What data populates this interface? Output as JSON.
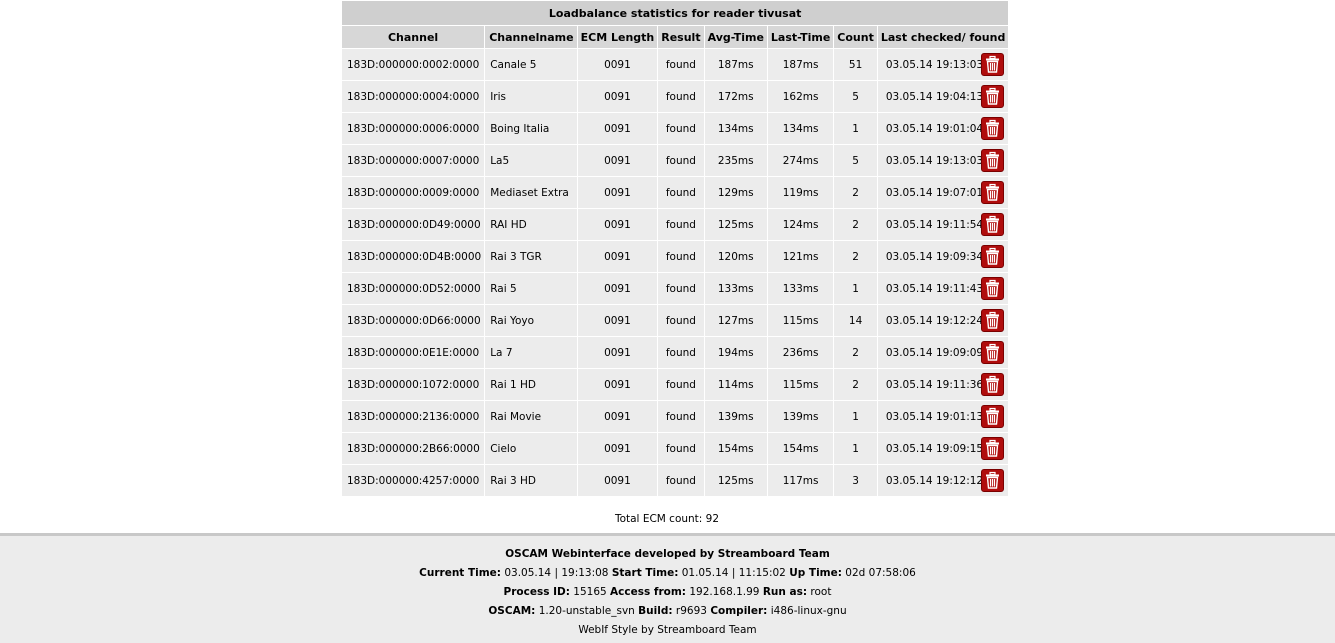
{
  "table": {
    "title": "Loadbalance statistics for reader tivusat",
    "headers": {
      "channel": "Channel",
      "channelname": "Channelname",
      "ecm_length": "ECM Length",
      "result": "Result",
      "avg_time": "Avg-Time",
      "last_time": "Last-Time",
      "count": "Count",
      "last_checked": "Last checked/ found"
    },
    "rows": [
      {
        "channel": "183D:000000:0002:0000",
        "name": "Canale 5",
        "ecm": "0091",
        "result": "found",
        "avg": "187ms",
        "last": "187ms",
        "count": "51",
        "checked": "03.05.14 19:13:03"
      },
      {
        "channel": "183D:000000:0004:0000",
        "name": "Iris",
        "ecm": "0091",
        "result": "found",
        "avg": "172ms",
        "last": "162ms",
        "count": "5",
        "checked": "03.05.14 19:04:13"
      },
      {
        "channel": "183D:000000:0006:0000",
        "name": "Boing Italia",
        "ecm": "0091",
        "result": "found",
        "avg": "134ms",
        "last": "134ms",
        "count": "1",
        "checked": "03.05.14 19:01:04"
      },
      {
        "channel": "183D:000000:0007:0000",
        "name": "La5",
        "ecm": "0091",
        "result": "found",
        "avg": "235ms",
        "last": "274ms",
        "count": "5",
        "checked": "03.05.14 19:13:03"
      },
      {
        "channel": "183D:000000:0009:0000",
        "name": "Mediaset Extra",
        "ecm": "0091",
        "result": "found",
        "avg": "129ms",
        "last": "119ms",
        "count": "2",
        "checked": "03.05.14 19:07:01"
      },
      {
        "channel": "183D:000000:0D49:0000",
        "name": "RAI HD",
        "ecm": "0091",
        "result": "found",
        "avg": "125ms",
        "last": "124ms",
        "count": "2",
        "checked": "03.05.14 19:11:54"
      },
      {
        "channel": "183D:000000:0D4B:0000",
        "name": "Rai 3 TGR",
        "ecm": "0091",
        "result": "found",
        "avg": "120ms",
        "last": "121ms",
        "count": "2",
        "checked": "03.05.14 19:09:34"
      },
      {
        "channel": "183D:000000:0D52:0000",
        "name": "Rai 5",
        "ecm": "0091",
        "result": "found",
        "avg": "133ms",
        "last": "133ms",
        "count": "1",
        "checked": "03.05.14 19:11:43"
      },
      {
        "channel": "183D:000000:0D66:0000",
        "name": "Rai Yoyo",
        "ecm": "0091",
        "result": "found",
        "avg": "127ms",
        "last": "115ms",
        "count": "14",
        "checked": "03.05.14 19:12:24"
      },
      {
        "channel": "183D:000000:0E1E:0000",
        "name": "La 7",
        "ecm": "0091",
        "result": "found",
        "avg": "194ms",
        "last": "236ms",
        "count": "2",
        "checked": "03.05.14 19:09:09"
      },
      {
        "channel": "183D:000000:1072:0000",
        "name": "Rai 1 HD",
        "ecm": "0091",
        "result": "found",
        "avg": "114ms",
        "last": "115ms",
        "count": "2",
        "checked": "03.05.14 19:11:36"
      },
      {
        "channel": "183D:000000:2136:0000",
        "name": "Rai Movie",
        "ecm": "0091",
        "result": "found",
        "avg": "139ms",
        "last": "139ms",
        "count": "1",
        "checked": "03.05.14 19:01:13"
      },
      {
        "channel": "183D:000000:2B66:0000",
        "name": "Cielo",
        "ecm": "0091",
        "result": "found",
        "avg": "154ms",
        "last": "154ms",
        "count": "1",
        "checked": "03.05.14 19:09:15"
      },
      {
        "channel": "183D:000000:4257:0000",
        "name": "Rai 3 HD",
        "ecm": "0091",
        "result": "found",
        "avg": "125ms",
        "last": "117ms",
        "count": "3",
        "checked": "03.05.14 19:12:12"
      }
    ],
    "delete_icon": "trash-icon",
    "total_label": "Total ECM count: 92"
  },
  "footer": {
    "developed_by": "OSCAM Webinterface developed by Streamboard Team",
    "current_time_label": "Current Time:",
    "current_time": "03.05.14 | 19:13:08",
    "start_time_label": "Start Time:",
    "start_time": "01.05.14 | 11:15:02",
    "up_time_label": "Up Time:",
    "up_time": "02d 07:58:06",
    "process_id_label": "Process ID:",
    "process_id": "15165",
    "access_from_label": "Access from:",
    "access_from": "192.168.1.99",
    "run_as_label": "Run as:",
    "run_as": "root",
    "oscam_label": "OSCAM:",
    "oscam_version": "1.20-unstable_svn",
    "build_label": "Build:",
    "build": "r9693",
    "compiler_label": "Compiler:",
    "compiler": "i486-linux-gnu",
    "style": "WebIf Style by Streamboard Team"
  },
  "colors": {
    "delete_button": "#b00d0d",
    "header_bg": "#d7d7d7",
    "row_bg": "#ececec",
    "footer_bg": "#ececec"
  }
}
